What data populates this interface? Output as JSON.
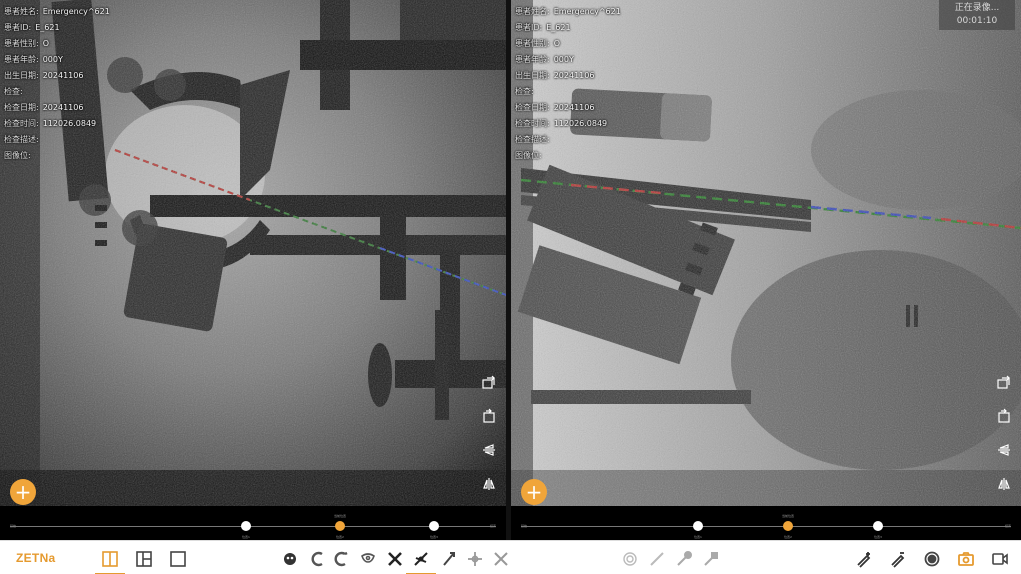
{
  "left_view": {
    "info": [
      {
        "label": "患者姓名:",
        "value": "Emergency^621"
      },
      {
        "label": "患者ID:",
        "value": "E_621"
      },
      {
        "label": "患者性别:",
        "value": "O"
      },
      {
        "label": "患者年龄:",
        "value": "000Y"
      },
      {
        "label": "出生日期:",
        "value": "20241106"
      },
      {
        "label": "检查:",
        "value": ""
      },
      {
        "label": "检查日期:",
        "value": "20241106"
      },
      {
        "label": "检查时间:",
        "value": "112026.0849"
      },
      {
        "label": "检查描述:",
        "value": ""
      },
      {
        "label": "图像位:",
        "value": ""
      }
    ],
    "timeline": {
      "start": "起始",
      "mid_top": "当前位置",
      "end": "结束",
      "left_dot": "位置1",
      "mid_dot": "位置2",
      "right_dot": "位置3"
    }
  },
  "right_view": {
    "info": [
      {
        "label": "患者姓名:",
        "value": "Emergency^621"
      },
      {
        "label": "患者ID:",
        "value": "E_621"
      },
      {
        "label": "患者性别:",
        "value": "O"
      },
      {
        "label": "患者年龄:",
        "value": "000Y"
      },
      {
        "label": "出生日期:",
        "value": "20241106"
      },
      {
        "label": "检查:",
        "value": ""
      },
      {
        "label": "检查日期:",
        "value": "20241106"
      },
      {
        "label": "检查时间:",
        "value": "112026.0849"
      },
      {
        "label": "检查描述:",
        "value": ""
      },
      {
        "label": "图像位:",
        "value": ""
      }
    ],
    "recording": {
      "status": "正在录像...",
      "time": "00:01:10"
    },
    "timeline": {
      "start": "起始",
      "mid_top": "当前位置",
      "end": "结束",
      "left_dot": "位置1",
      "mid_dot": "位置2",
      "right_dot": "位置3"
    }
  },
  "toolbar": {
    "brand": "ZETNa",
    "accent": "#e59a2f"
  },
  "colors": {
    "accent": "#f0a53a",
    "toolbar_bg": "#ffffff"
  }
}
